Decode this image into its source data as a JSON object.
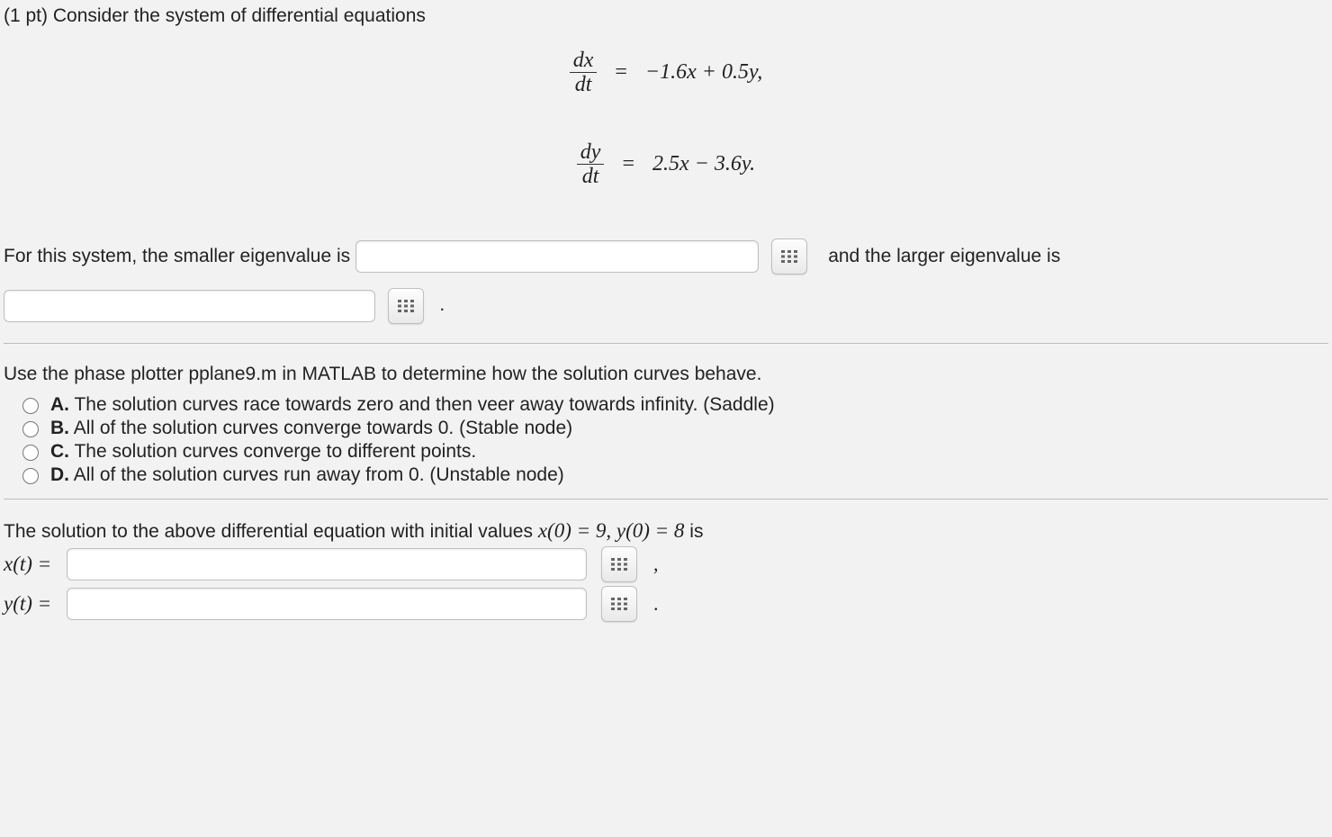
{
  "prompt": {
    "points_prefix": "(1 pt) ",
    "intro": "Consider the system of differential equations"
  },
  "equations": {
    "eq1": {
      "lhs_num": "dx",
      "lhs_den": "dt",
      "rhs": "−1.6x + 0.5y,"
    },
    "eq2": {
      "lhs_num": "dy",
      "lhs_den": "dt",
      "rhs": "2.5x − 3.6y."
    }
  },
  "eigen": {
    "before": "For this system, the smaller eigenvalue is",
    "after_first": "and the larger eigenvalue is",
    "period": "."
  },
  "phase_prompt": "Use the phase plotter pplane9.m in MATLAB to determine how the solution curves behave.",
  "options": {
    "A": "The solution curves race towards zero and then veer away towards infinity. (Saddle)",
    "B": "All of the solution curves converge towards 0. (Stable node)",
    "C": "The solution curves converge to different points.",
    "D": "All of the solution curves run away from 0. (Unstable node)"
  },
  "solution": {
    "intro_before": "The solution to the above differential equation with initial values ",
    "ic": "x(0) = 9,  y(0) = 8",
    "intro_after": " is",
    "x_label": "x(t) =",
    "y_label": "y(t) =",
    "comma": ",",
    "period": "."
  }
}
